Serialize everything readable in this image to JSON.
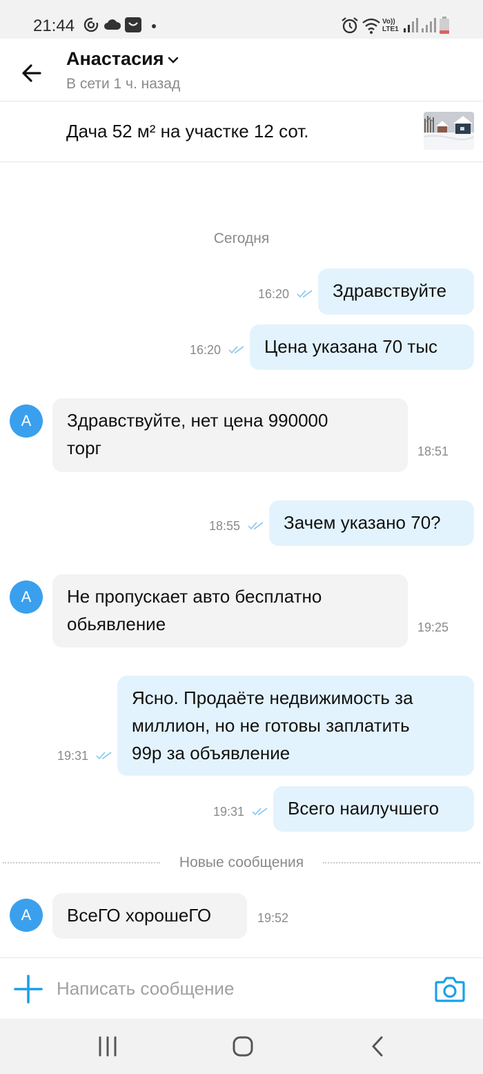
{
  "status_bar": {
    "time": "21:44",
    "icons": [
      "sync-icon",
      "cloud-icon",
      "bag-icon",
      "dot-icon",
      "alarm-icon",
      "wifi-icon",
      "volte-icon",
      "signal-icon",
      "signal-icon",
      "battery-icon"
    ],
    "volte_label": "Vo)) LTE1"
  },
  "header": {
    "name": "Анастасия",
    "status": "В сети 1 ч. назад",
    "icons": {
      "back": "arrow-left-icon",
      "dropdown": "chevron-down-icon"
    }
  },
  "listing": {
    "title": "Дача 52 м² на участке 12 сот."
  },
  "chat": {
    "date_separator": "Сегодня",
    "new_messages_label": "Новые сообщения",
    "messages": [
      {
        "direction": "out",
        "text": "Здравствуйте",
        "time": "16:20",
        "read": true
      },
      {
        "direction": "out",
        "text": "Цена указана 70 тыс",
        "time": "16:20",
        "read": true
      },
      {
        "direction": "in",
        "avatar": "А",
        "text_lines": [
          "Здравствуйте,  нет цена 990000",
          "торг"
        ],
        "time": "18:51"
      },
      {
        "direction": "out",
        "text": "Зачем указано 70?",
        "time": "18:55",
        "read": true
      },
      {
        "direction": "in",
        "avatar": "А",
        "text_lines": [
          "Не пропускает авто бесплатно",
          "обьявление"
        ],
        "time": "19:25"
      },
      {
        "direction": "out",
        "text_lines": [
          "Ясно. Продаёте недвижимость за",
          "миллион, но не готовы заплатить",
          "99р за объявление"
        ],
        "time": "19:31",
        "read": true
      },
      {
        "direction": "out",
        "text": "Всего наилучшего",
        "time": "19:31",
        "read": true
      },
      {
        "direction": "in",
        "avatar": "А",
        "text": "ВсеГО хорошеГО",
        "time": "19:52"
      }
    ]
  },
  "composer": {
    "placeholder": "Написать сообщение",
    "value": "",
    "icons": {
      "attach": "plus-icon",
      "camera": "camera-icon"
    }
  },
  "nav_bar": {
    "buttons": [
      "recent-apps-icon",
      "home-icon",
      "back-icon"
    ]
  },
  "colors": {
    "accent": "#1aa0e8",
    "avatar": "#3aa0ee",
    "outgoing_bubble": "#e3f3fd",
    "incoming_bubble": "#f3f3f3",
    "read_ticks": "#8fcaf0",
    "muted_text": "#8a8a8a"
  }
}
